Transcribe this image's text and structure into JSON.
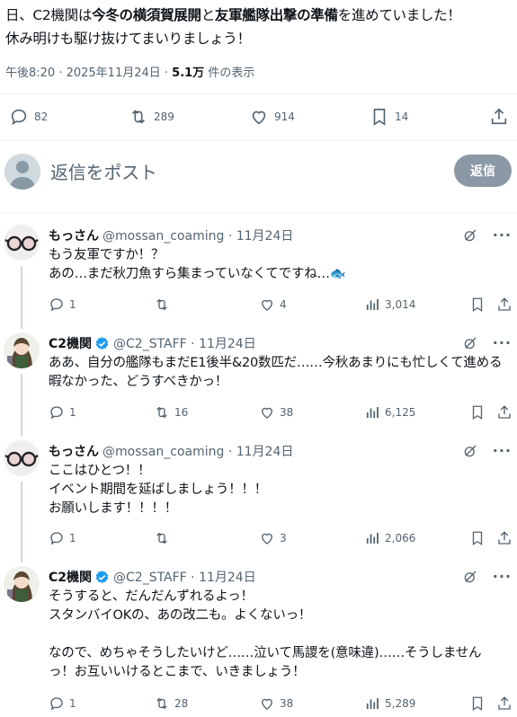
{
  "main_tweet": {
    "text_segments": [
      {
        "text": "日、C2機関は",
        "bold": false
      },
      {
        "text": "今冬の横須賀展開",
        "bold": true
      },
      {
        "text": "と",
        "bold": false
      },
      {
        "text": "友軍艦隊出撃の準備",
        "bold": true
      },
      {
        "text": "を進めていました！",
        "bold": false
      }
    ],
    "text_line2": "休み明けも駆け抜けてまいりましょう！",
    "meta_time": "午後8:20 · 2025年11月24日 · ",
    "meta_views": "5.1万",
    "meta_views_suffix": " 件の表示",
    "stats": {
      "replies": "82",
      "reposts": "289",
      "likes": "914",
      "bookmarks": "14"
    }
  },
  "reply_compose": {
    "placeholder": "返信をポスト",
    "button_label": "返信"
  },
  "replies": [
    {
      "name": "もっさん",
      "handle": "@mossan_coaming · 11月24日",
      "verified": false,
      "avatar": "glasses",
      "lines": [
        "もう友軍ですか！？",
        "あの…まだ秋刀魚すら集まっていなくてですね…🐟"
      ],
      "stats": {
        "replies": "1",
        "reposts": "",
        "likes": "4",
        "views": "3,014"
      }
    },
    {
      "name": "C2機関",
      "handle": "@C2_STAFF · 11月24日",
      "verified": true,
      "avatar": "character",
      "lines": [
        "ああ、自分の艦隊もまだE1後半&20数匹だ……今秋あまりにも忙しくて進める",
        "暇なかった、どうすべきかっ！"
      ],
      "stats": {
        "replies": "1",
        "reposts": "16",
        "likes": "38",
        "views": "6,125"
      }
    },
    {
      "name": "もっさん",
      "handle": "@mossan_coaming · 11月24日",
      "verified": false,
      "avatar": "glasses",
      "lines": [
        "ここはひとつ！！",
        "イベント期間を延ばしましょう！！！",
        "お願いします！！！！"
      ],
      "stats": {
        "replies": "1",
        "reposts": "",
        "likes": "3",
        "views": "2,066"
      }
    },
    {
      "name": "C2機関",
      "handle": "@C2_STAFF · 11月24日",
      "verified": true,
      "avatar": "character",
      "lines": [
        "そうすると、だんだんずれるよっ！",
        "スタンバイOKの、あの改二も。よくないっ！",
        "",
        "なので、めちゃそうしたいけど……泣いて馬謖を(意味違)……そうしません",
        "っ！お互いいけるとこまで、いきましょう！"
      ],
      "stats": {
        "replies": "1",
        "reposts": "28",
        "likes": "38",
        "views": "5,289"
      }
    }
  ],
  "colors": {
    "text": "#0f1419",
    "muted": "#536471",
    "divider": "#eff3f4",
    "verified": "#1d9bf0",
    "reply_button": "#8b98a5"
  }
}
